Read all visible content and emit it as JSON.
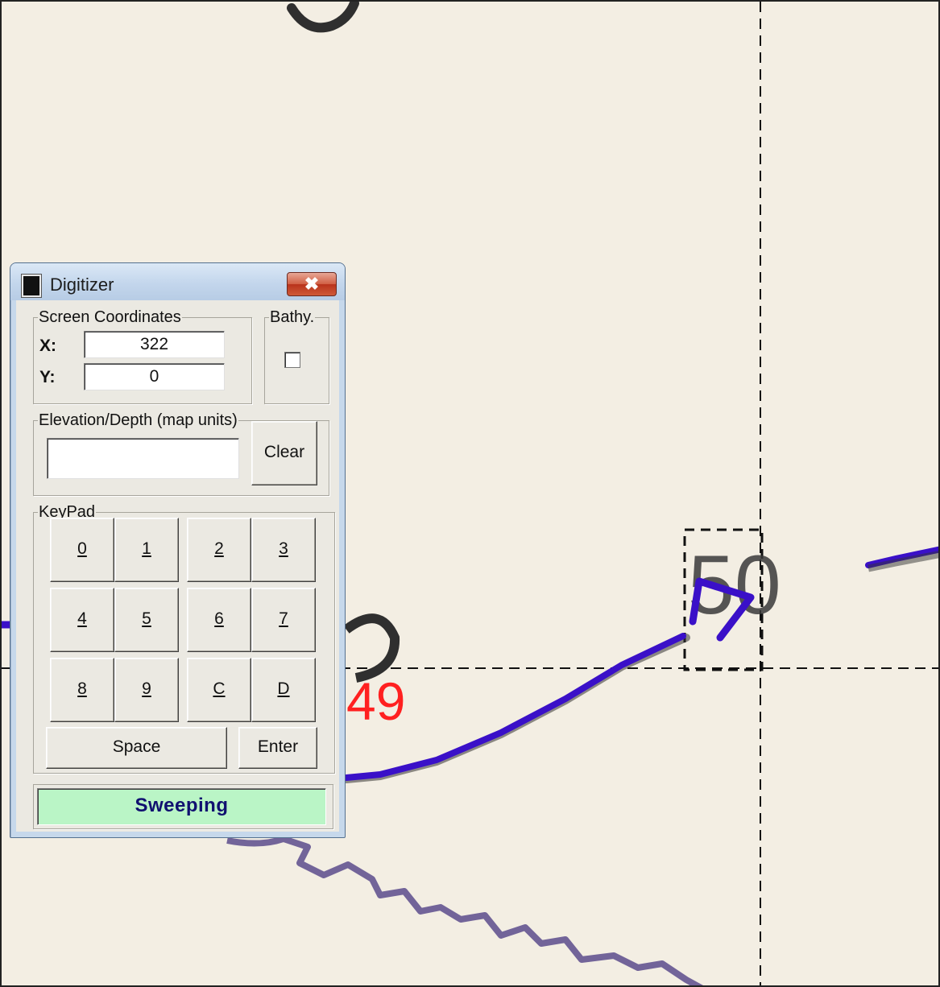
{
  "map": {
    "contour_label": "49",
    "colors": {
      "background": "#f3eee3",
      "digitized_line": "#3a10c8",
      "contour_ink": "#333333",
      "label_red": "#ff2020"
    }
  },
  "window": {
    "title": "Digitizer",
    "close_glyph": "✖",
    "screen_coordinates": {
      "legend": "Screen Coordinates",
      "x_label": "X:",
      "x_value": "322",
      "y_label": "Y:",
      "y_value": "0"
    },
    "bathy": {
      "legend": "Bathy.",
      "checked": false
    },
    "elevation": {
      "legend": "Elevation/Depth (map units)",
      "value": "",
      "clear_label": "Clear"
    },
    "keypad": {
      "legend": "KeyPad",
      "keys": [
        "0",
        "1",
        "2",
        "3",
        "4",
        "5",
        "6",
        "7",
        "8",
        "9",
        "C",
        "D"
      ],
      "space_label": "Space",
      "enter_label": "Enter"
    },
    "status": {
      "text": "Sweeping",
      "color": "#baf5c6"
    }
  }
}
